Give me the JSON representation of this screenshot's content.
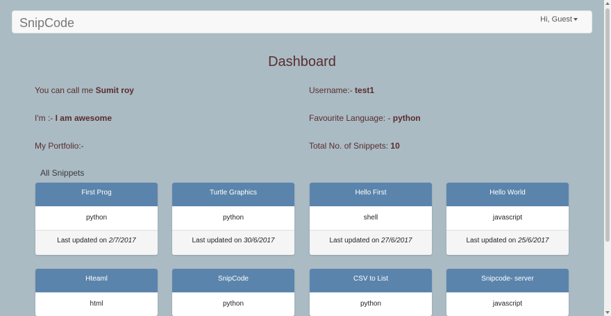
{
  "navbar": {
    "brand": "SnipCode",
    "user_menu_label": "Hi, Guest"
  },
  "dashboard": {
    "title": "Dashboard",
    "name_label": "You can call me ",
    "name_value": "Sumit roy",
    "username_label": "Username:- ",
    "username_value": "test1",
    "about_label": "I'm :- ",
    "about_value": "I am awesome",
    "language_label": "Favourite Language: - ",
    "language_value": "python",
    "portfolio_label": "My Portfolio:-",
    "snippets_count_label": "Total No. of Snippets: ",
    "snippets_count_value": "10"
  },
  "snippets_section": {
    "label": "All Snippets",
    "updated_prefix": "Last updated on ",
    "cards": [
      {
        "title": "First Prog",
        "language": "python",
        "date": "2/7/2017"
      },
      {
        "title": "Turtle Graphics",
        "language": "python",
        "date": "30/6/2017"
      },
      {
        "title": "Hello First",
        "language": "shell",
        "date": "27/6/2017"
      },
      {
        "title": "Hello World",
        "language": "javascript",
        "date": "25/6/2017"
      },
      {
        "title": "Hteaml",
        "language": "html",
        "date": ""
      },
      {
        "title": "SnipCode",
        "language": "python",
        "date": ""
      },
      {
        "title": "CSV to List",
        "language": "python",
        "date": ""
      },
      {
        "title": "Snipcode- server",
        "language": "javascript",
        "date": ""
      }
    ]
  }
}
